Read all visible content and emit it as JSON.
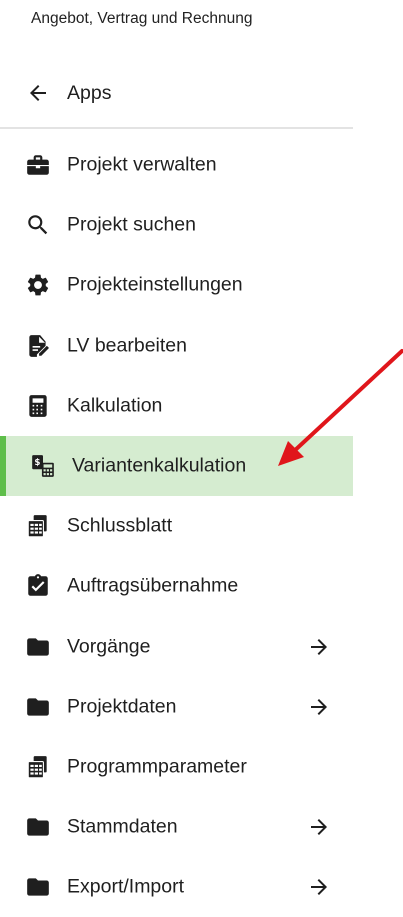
{
  "header": {
    "title": "Angebot, Vertrag und Rechnung"
  },
  "back": {
    "label": "Apps",
    "icon": "arrow-left-icon"
  },
  "colors": {
    "active_bg": "#d5ecd0",
    "active_bar": "#5ebe4a",
    "annotation": "#e0161b"
  },
  "menu": {
    "items": [
      {
        "label": "Projekt verwalten",
        "icon": "briefcase-icon"
      },
      {
        "label": "Projekt suchen",
        "icon": "search-icon"
      },
      {
        "label": "Projekteinstellungen",
        "icon": "gear-icon"
      },
      {
        "label": "LV bearbeiten",
        "icon": "document-edit-icon"
      },
      {
        "label": "Kalkulation",
        "icon": "calculator-icon"
      },
      {
        "label": "Variantenkalkulation",
        "icon": "variant-calculation-icon",
        "active": true
      },
      {
        "label": "Schlussblatt",
        "icon": "spreadsheet-icon"
      },
      {
        "label": "Auftragsübernahme",
        "icon": "clipboard-check-icon"
      },
      {
        "label": "Vorgänge",
        "icon": "folder-icon",
        "has_submenu": true
      },
      {
        "label": "Projektdaten",
        "icon": "folder-icon",
        "has_submenu": true
      },
      {
        "label": "Programmparameter",
        "icon": "spreadsheet-icon"
      },
      {
        "label": "Stammdaten",
        "icon": "folder-icon",
        "has_submenu": true
      },
      {
        "label": "Export/Import",
        "icon": "folder-icon",
        "has_submenu": true
      }
    ]
  }
}
